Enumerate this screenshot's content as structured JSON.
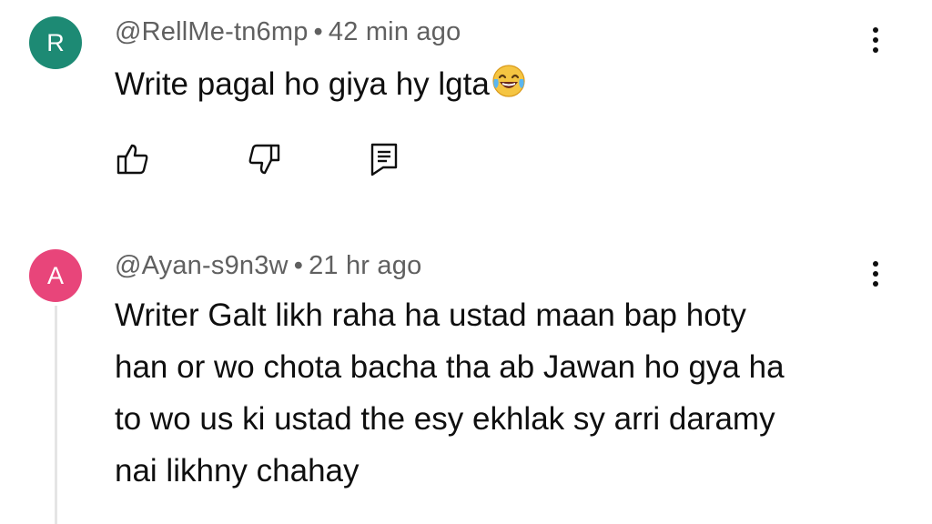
{
  "comments": [
    {
      "avatar_letter": "R",
      "avatar_color": "#1d8a74",
      "handle": "@RellMe-tn6mp",
      "separator": "•",
      "time": "42 min ago",
      "text": "Write pagal ho giya hy lgta",
      "emoji": "face-with-tears-of-joy"
    },
    {
      "avatar_letter": "A",
      "avatar_color": "#e8457a",
      "handle": "@Ayan-s9n3w",
      "separator": "•",
      "time": "21 hr ago",
      "lines": [
        "Writer Galt likh raha ha ustad maan bap hoty",
        "han or wo chota bacha tha ab Jawan ho gya ha",
        "to wo us ki ustad the esy ekhlak sy arri daramy",
        "nai likhny chahay"
      ]
    }
  ],
  "icons": [
    "like-icon",
    "dislike-icon",
    "reply-icon",
    "more-options-icon"
  ]
}
